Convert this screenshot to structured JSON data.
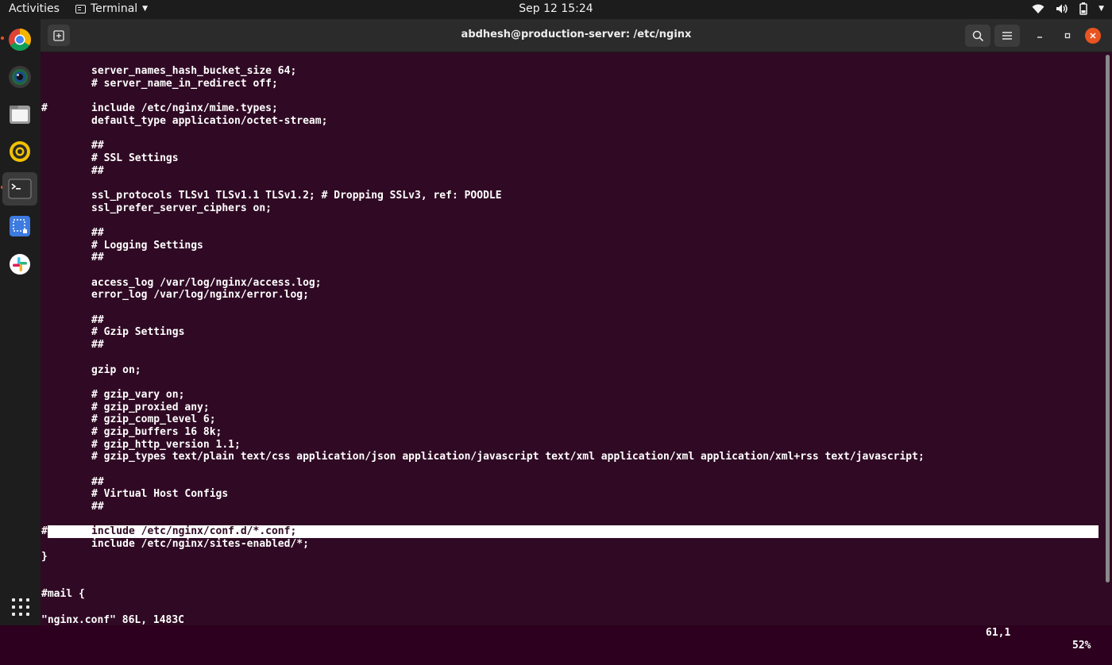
{
  "topbar": {
    "activities": "Activities",
    "app_name": "Terminal",
    "clock": "Sep 12  15:24"
  },
  "window": {
    "title": "abdhesh@production-server: /etc/nginx"
  },
  "dock": {
    "items": [
      {
        "name": "chrome-icon",
        "running": true
      },
      {
        "name": "camera-icon",
        "running": false
      },
      {
        "name": "files-icon",
        "running": false
      },
      {
        "name": "rhythmbox-icon",
        "running": false
      },
      {
        "name": "terminal-icon",
        "running": true,
        "active": true
      },
      {
        "name": "screenshot-icon",
        "running": false
      },
      {
        "name": "slack-icon",
        "running": false
      }
    ]
  },
  "editor": {
    "lines": [
      {
        "hash": "",
        "code": "server_names_hash_bucket_size 64;"
      },
      {
        "hash": "",
        "code": "# server_name_in_redirect off;"
      },
      {
        "hash": "",
        "code": ""
      },
      {
        "hash": "#",
        "code": "include /etc/nginx/mime.types;"
      },
      {
        "hash": "",
        "code": "default_type application/octet-stream;"
      },
      {
        "hash": "",
        "code": ""
      },
      {
        "hash": "",
        "code": "##"
      },
      {
        "hash": "",
        "code": "# SSL Settings"
      },
      {
        "hash": "",
        "code": "##"
      },
      {
        "hash": "",
        "code": ""
      },
      {
        "hash": "",
        "code": "ssl_protocols TLSv1 TLSv1.1 TLSv1.2; # Dropping SSLv3, ref: POODLE"
      },
      {
        "hash": "",
        "code": "ssl_prefer_server_ciphers on;"
      },
      {
        "hash": "",
        "code": ""
      },
      {
        "hash": "",
        "code": "##"
      },
      {
        "hash": "",
        "code": "# Logging Settings"
      },
      {
        "hash": "",
        "code": "##"
      },
      {
        "hash": "",
        "code": ""
      },
      {
        "hash": "",
        "code": "access_log /var/log/nginx/access.log;"
      },
      {
        "hash": "",
        "code": "error_log /var/log/nginx/error.log;"
      },
      {
        "hash": "",
        "code": ""
      },
      {
        "hash": "",
        "code": "##"
      },
      {
        "hash": "",
        "code": "# Gzip Settings"
      },
      {
        "hash": "",
        "code": "##"
      },
      {
        "hash": "",
        "code": ""
      },
      {
        "hash": "",
        "code": "gzip on;"
      },
      {
        "hash": "",
        "code": ""
      },
      {
        "hash": "",
        "code": "# gzip_vary on;"
      },
      {
        "hash": "",
        "code": "# gzip_proxied any;"
      },
      {
        "hash": "",
        "code": "# gzip_comp_level 6;"
      },
      {
        "hash": "",
        "code": "# gzip_buffers 16 8k;"
      },
      {
        "hash": "",
        "code": "# gzip_http_version 1.1;"
      },
      {
        "hash": "",
        "code": "# gzip_types text/plain text/css application/json application/javascript text/xml application/xml application/xml+rss text/javascript;"
      },
      {
        "hash": "",
        "code": ""
      },
      {
        "hash": "",
        "code": "##"
      },
      {
        "hash": "",
        "code": "# Virtual Host Configs"
      },
      {
        "hash": "",
        "code": "##"
      },
      {
        "hash": "",
        "code": ""
      },
      {
        "hash": "#",
        "code": "include /etc/nginx/conf.d/*.conf;",
        "highlight": true
      },
      {
        "hash": "",
        "code": "include /etc/nginx/sites-enabled/*;"
      },
      {
        "hash": "}",
        "code": ""
      },
      {
        "hash": "",
        "code": ""
      },
      {
        "hash": "",
        "code": ""
      },
      {
        "hash": "#mail {",
        "code": ""
      }
    ],
    "status": {
      "file_info": "\"nginx.conf\" 86L, 1483C",
      "cursor_position": "61,1",
      "scroll_percent": "52%"
    }
  }
}
